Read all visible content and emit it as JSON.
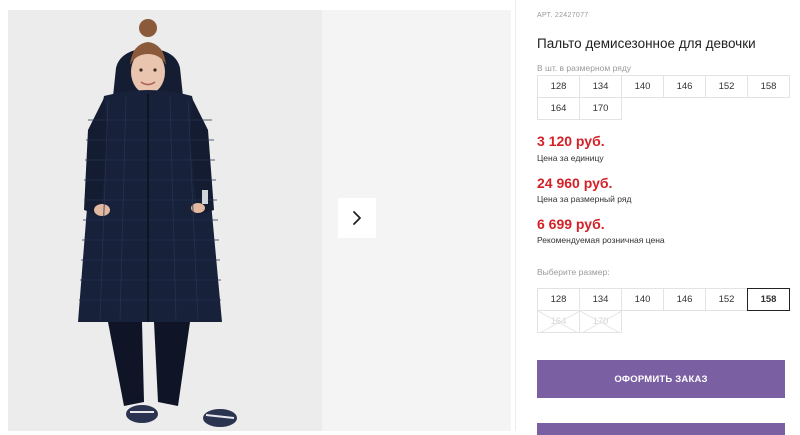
{
  "product": {
    "article_label": "АРТ.",
    "article_number": "22427077",
    "title": "Пальто демисезонное для девочки"
  },
  "pack": {
    "label": "В шт. в размерном ряду",
    "sizes": [
      "128",
      "134",
      "140",
      "146",
      "152",
      "158",
      "164",
      "170"
    ]
  },
  "prices": {
    "unit_price": "3 120 руб.",
    "unit_caption": "Цена за единицу",
    "pack_price": "24 960 руб.",
    "pack_caption": "Цена за размерный ряд",
    "retail_price": "6 699 руб.",
    "retail_caption": "Рекомендуемая розничная цена"
  },
  "size_select": {
    "label": "Выберите размер:",
    "options": [
      {
        "value": "128",
        "state": "available"
      },
      {
        "value": "134",
        "state": "available"
      },
      {
        "value": "140",
        "state": "available"
      },
      {
        "value": "146",
        "state": "available"
      },
      {
        "value": "152",
        "state": "available"
      },
      {
        "value": "158",
        "state": "selected"
      },
      {
        "value": "164",
        "state": "unavailable"
      },
      {
        "value": "170",
        "state": "unavailable"
      }
    ]
  },
  "actions": {
    "order_label": "ОФОРМИТЬ ЗАКАЗ"
  },
  "colors": {
    "accent": "#7b5fa3",
    "price": "#d42127",
    "coat": "#17213a"
  },
  "icons": {
    "next": "chevron-right-icon"
  }
}
